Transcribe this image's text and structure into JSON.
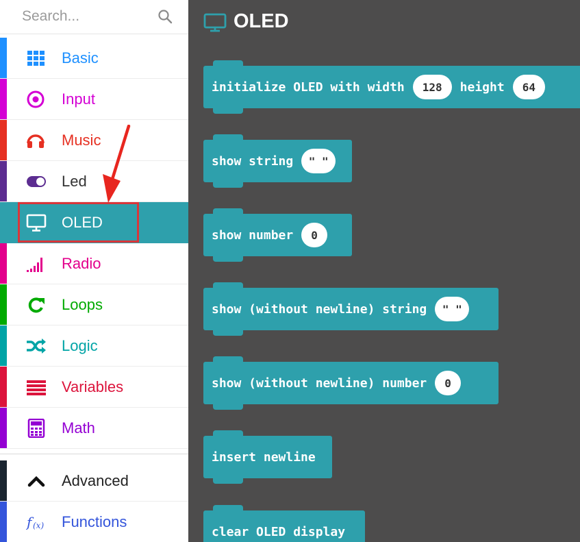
{
  "search": {
    "placeholder": "Search..."
  },
  "categories": [
    {
      "label": "Basic",
      "icon": "grid-icon",
      "color": "#1e90ff"
    },
    {
      "label": "Input",
      "icon": "target-icon",
      "color": "#d400d4"
    },
    {
      "label": "Music",
      "icon": "headphones-icon",
      "color": "#e63022"
    },
    {
      "label": "Led",
      "icon": "toggle-icon",
      "color": "#5c2d91"
    },
    {
      "label": "OLED",
      "icon": "monitor-icon",
      "color": "#2ea0ac"
    },
    {
      "label": "Radio",
      "icon": "signal-bars-icon",
      "color": "#e3008c"
    },
    {
      "label": "Loops",
      "icon": "refresh-icon",
      "color": "#00aa00"
    },
    {
      "label": "Logic",
      "icon": "shuffle-icon",
      "color": "#00a4a6"
    },
    {
      "label": "Variables",
      "icon": "lines-icon",
      "color": "#dc143c"
    },
    {
      "label": "Math",
      "icon": "calculator-icon",
      "color": "#9400d3"
    }
  ],
  "advanced": {
    "label": "Advanced",
    "icon": "chevron-up-icon"
  },
  "functions": {
    "label": "Functions",
    "icon": "function-icon",
    "color": "#3455db"
  },
  "flyout": {
    "title": "OLED",
    "blocks": [
      {
        "text": "initialize OLED with width",
        "arg1": "128",
        "text2": "height",
        "arg2": "64"
      },
      {
        "text": "show string",
        "arg1": "\" \""
      },
      {
        "text": "show number",
        "arg1": "0"
      },
      {
        "text": "show (without newline) string",
        "arg1": "\" \""
      },
      {
        "text": "show (without newline) number",
        "arg1": "0"
      },
      {
        "text": "insert newline"
      },
      {
        "text": "clear OLED display"
      }
    ]
  },
  "colors": {
    "workspace_bg": "#4d4c4c",
    "block_color": "#2ea0ac",
    "highlight": "#d9363a"
  }
}
